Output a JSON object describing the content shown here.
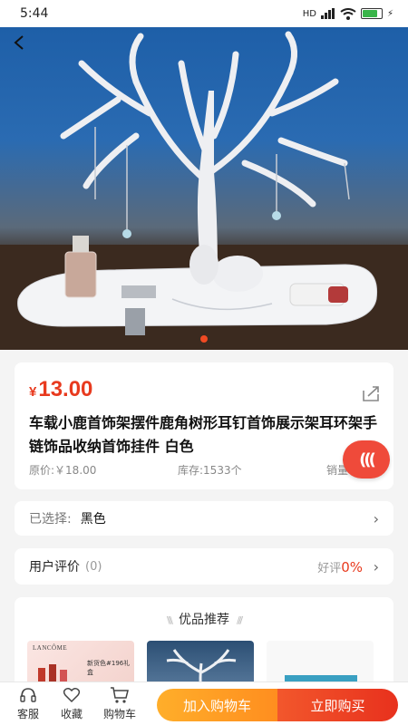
{
  "status_bar": {
    "time": "5:44",
    "network": "HD",
    "battery_level": 0.8
  },
  "product": {
    "currency": "¥",
    "price": "13.00",
    "title": "车载小鹿首饰架摆件鹿角树形耳钉首饰展示架耳环架手链饰品收纳首饰挂件 白色",
    "original_price": "原价:￥18.00",
    "stock": "库存:1533个",
    "sales": "销量"
  },
  "gallery": {
    "active_index": 0,
    "total": 1
  },
  "selection": {
    "label": "已选择:",
    "value": "黑色"
  },
  "reviews": {
    "label": "用户评价",
    "count": "(0)",
    "good_rate_label": "好评",
    "good_rate_value": "0%"
  },
  "recommend": {
    "title": "优品推荐",
    "items": [
      {
        "brand": "LANCÔME",
        "caption": "新货色#196礼盒"
      },
      {
        "brand": "",
        "caption": ""
      },
      {
        "brand": "",
        "caption": ""
      }
    ]
  },
  "bottom_nav": {
    "service": "客服",
    "favorite": "收藏",
    "cart": "购物车",
    "add_to_cart": "加入购物车",
    "buy_now": "立即购买"
  },
  "colors": {
    "accent": "#e83a1e",
    "orange": "#ff9a24",
    "red_button": "#ec3d20"
  }
}
